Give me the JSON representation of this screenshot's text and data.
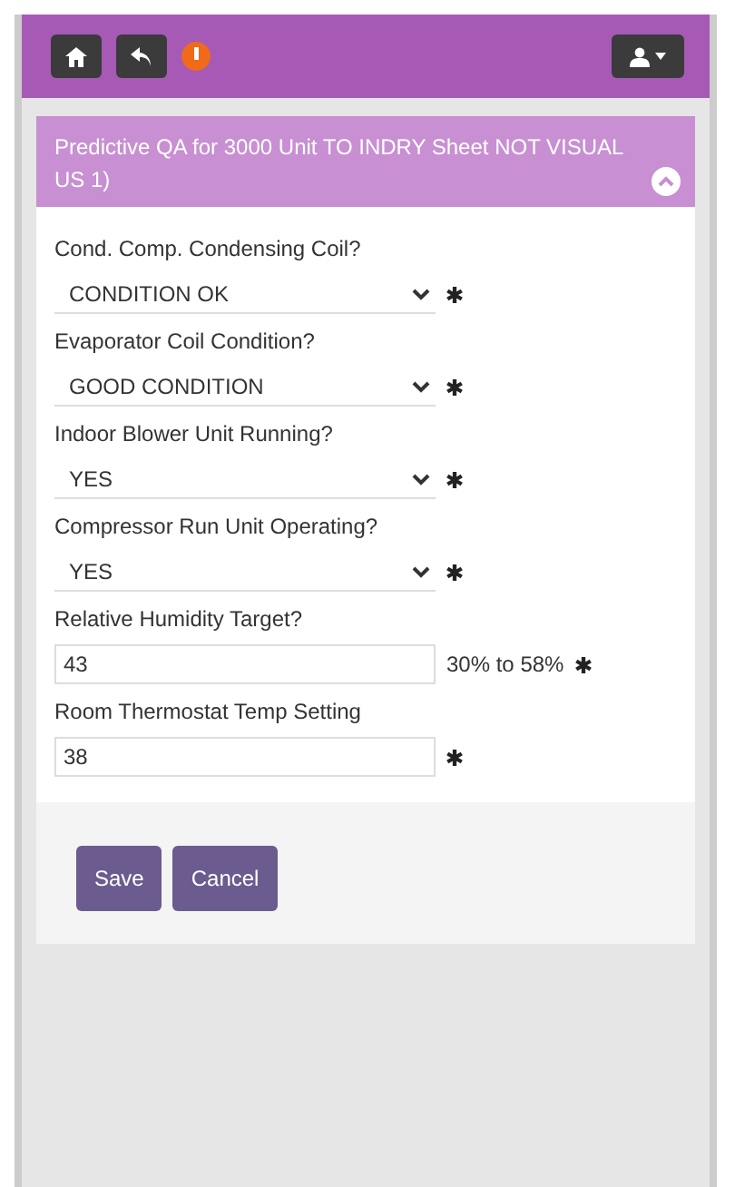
{
  "panel": {
    "title": "Predictive QA for 3000 Unit TO INDRY Sheet NOT VISUAL US 1)",
    "expanded": true
  },
  "fields": [
    {
      "kind": "select",
      "label": "Cond. Comp. Condensing Coil?",
      "value": "CONDITION OK",
      "required": true
    },
    {
      "kind": "select",
      "label": "Evaporator Coil Condition?",
      "value": "GOOD CONDITION",
      "required": true
    },
    {
      "kind": "select",
      "label": "Indoor Blower Unit Running?",
      "value": "YES",
      "required": true
    },
    {
      "kind": "select",
      "label": "Compressor Run Unit Operating?",
      "value": "YES",
      "required": true
    },
    {
      "kind": "text",
      "label": "Relative Humidity Target?",
      "value": "43",
      "hint": "30% to 58%",
      "required": true
    },
    {
      "kind": "text",
      "label": "Room Thermostat Temp Setting",
      "value": "38",
      "required": true
    }
  ],
  "buttons": [
    "Save",
    "Cancel"
  ]
}
